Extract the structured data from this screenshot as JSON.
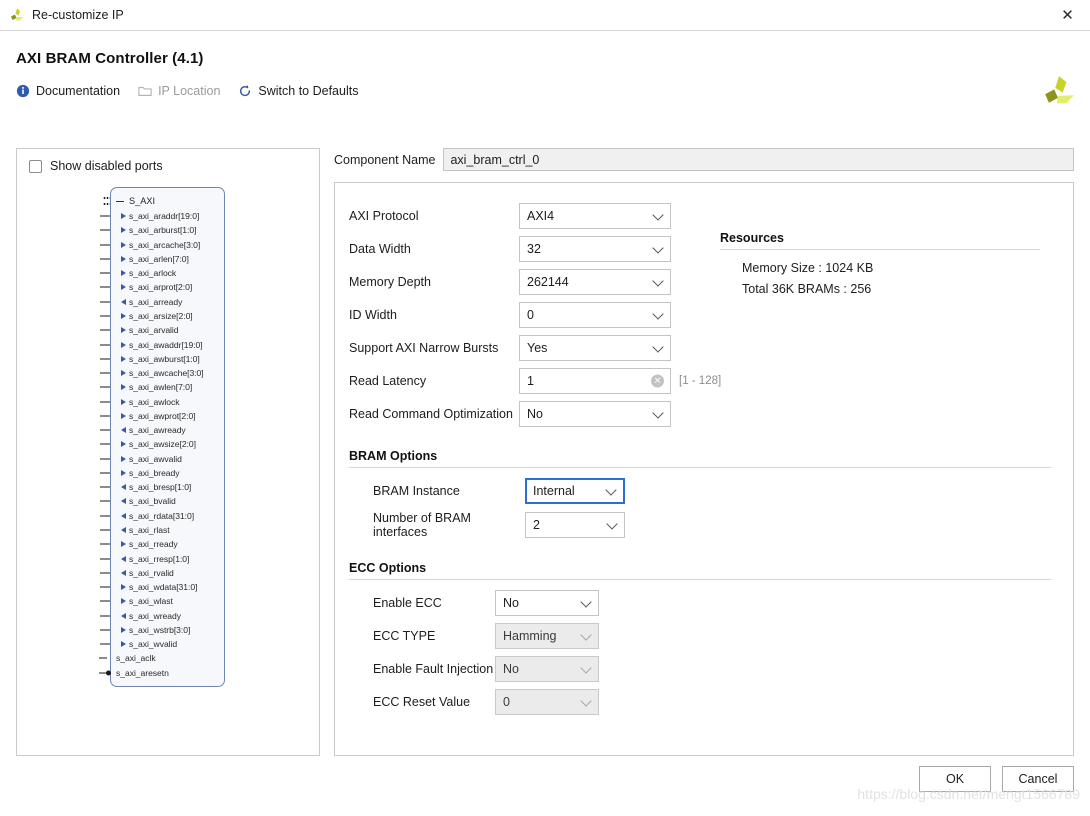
{
  "window": {
    "title": "Re-customize IP",
    "close_label": "✕",
    "logo_name": "xilinx-logo"
  },
  "header": {
    "title": "AXI BRAM Controller (4.1)",
    "toolbar": [
      {
        "label": "Documentation",
        "icon": "info-icon",
        "disabled": false
      },
      {
        "label": "IP Location",
        "icon": "folder-icon",
        "disabled": true
      },
      {
        "label": "Switch to Defaults",
        "icon": "refresh-icon",
        "disabled": false
      }
    ]
  },
  "ports_panel": {
    "show_disabled_label": "Show disabled ports",
    "show_disabled_checked": false,
    "bus_label": "S_AXI",
    "ports": [
      {
        "name": "s_axi_araddr[19:0]",
        "dir": "in"
      },
      {
        "name": "s_axi_arburst[1:0]",
        "dir": "in"
      },
      {
        "name": "s_axi_arcache[3:0]",
        "dir": "in"
      },
      {
        "name": "s_axi_arlen[7:0]",
        "dir": "in"
      },
      {
        "name": "s_axi_arlock",
        "dir": "in"
      },
      {
        "name": "s_axi_arprot[2:0]",
        "dir": "in"
      },
      {
        "name": "s_axi_arready",
        "dir": "out"
      },
      {
        "name": "s_axi_arsize[2:0]",
        "dir": "in"
      },
      {
        "name": "s_axi_arvalid",
        "dir": "in"
      },
      {
        "name": "s_axi_awaddr[19:0]",
        "dir": "in"
      },
      {
        "name": "s_axi_awburst[1:0]",
        "dir": "in"
      },
      {
        "name": "s_axi_awcache[3:0]",
        "dir": "in"
      },
      {
        "name": "s_axi_awlen[7:0]",
        "dir": "in"
      },
      {
        "name": "s_axi_awlock",
        "dir": "in"
      },
      {
        "name": "s_axi_awprot[2:0]",
        "dir": "in"
      },
      {
        "name": "s_axi_awready",
        "dir": "out"
      },
      {
        "name": "s_axi_awsize[2:0]",
        "dir": "in"
      },
      {
        "name": "s_axi_awvalid",
        "dir": "in"
      },
      {
        "name": "s_axi_bready",
        "dir": "in"
      },
      {
        "name": "s_axi_bresp[1:0]",
        "dir": "out"
      },
      {
        "name": "s_axi_bvalid",
        "dir": "out"
      },
      {
        "name": "s_axi_rdata[31:0]",
        "dir": "out"
      },
      {
        "name": "s_axi_rlast",
        "dir": "out"
      },
      {
        "name": "s_axi_rready",
        "dir": "in"
      },
      {
        "name": "s_axi_rresp[1:0]",
        "dir": "out"
      },
      {
        "name": "s_axi_rvalid",
        "dir": "out"
      },
      {
        "name": "s_axi_wdata[31:0]",
        "dir": "in"
      },
      {
        "name": "s_axi_wlast",
        "dir": "in"
      },
      {
        "name": "s_axi_wready",
        "dir": "out"
      },
      {
        "name": "s_axi_wstrb[3:0]",
        "dir": "in"
      },
      {
        "name": "s_axi_wvalid",
        "dir": "in"
      }
    ],
    "global_ports": [
      {
        "name": "s_axi_aclk",
        "marker": "clock"
      },
      {
        "name": "s_axi_aresetn",
        "marker": "reset-low"
      }
    ]
  },
  "config": {
    "component_name_label": "Component Name",
    "component_name_value": "axi_bram_ctrl_0",
    "params": [
      {
        "label": "AXI Protocol",
        "value": "AXI4",
        "type": "select",
        "state": "enabled"
      },
      {
        "label": "Data Width",
        "value": "32",
        "type": "select",
        "state": "enabled"
      },
      {
        "label": "Memory Depth",
        "value": "262144",
        "type": "select",
        "state": "enabled"
      },
      {
        "label": "ID Width",
        "value": "0",
        "type": "select",
        "state": "enabled"
      },
      {
        "label": "Support AXI Narrow Bursts",
        "value": "Yes",
        "type": "select",
        "state": "enabled"
      },
      {
        "label": "Read Latency",
        "value": "1",
        "type": "text",
        "state": "enabled",
        "hint": "[1 - 128]"
      },
      {
        "label": "Read Command Optimization",
        "value": "No",
        "type": "select",
        "state": "enabled"
      }
    ],
    "resources": {
      "title": "Resources",
      "lines": [
        "Memory Size : 1024 KB",
        "Total 36K BRAMs : 256"
      ]
    },
    "bram_options": {
      "title": "BRAM Options",
      "params": [
        {
          "label": "BRAM Instance",
          "value": "Internal",
          "state": "focused"
        },
        {
          "label": "Number of BRAM interfaces",
          "value": "2",
          "state": "enabled"
        }
      ]
    },
    "ecc_options": {
      "title": "ECC Options",
      "params": [
        {
          "label": "Enable ECC",
          "value": "No",
          "state": "enabled"
        },
        {
          "label": "ECC TYPE",
          "value": "Hamming",
          "state": "disabled"
        },
        {
          "label": "Enable Fault Injection",
          "value": "No",
          "state": "disabled"
        },
        {
          "label": "ECC Reset Value",
          "value": "0",
          "state": "disabled"
        }
      ]
    }
  },
  "footer": {
    "ok_label": "OK",
    "cancel_label": "Cancel",
    "watermark": "https://blog.csdn.net/mengt1566789"
  },
  "colors": {
    "accent_blue": "#2a6fd4",
    "port_arrow": "#3a57a8",
    "block_border": "#6f86b5",
    "logo_dark": "#8d931b",
    "logo_mid": "#c8d32a",
    "logo_light": "#e3ec6e"
  }
}
